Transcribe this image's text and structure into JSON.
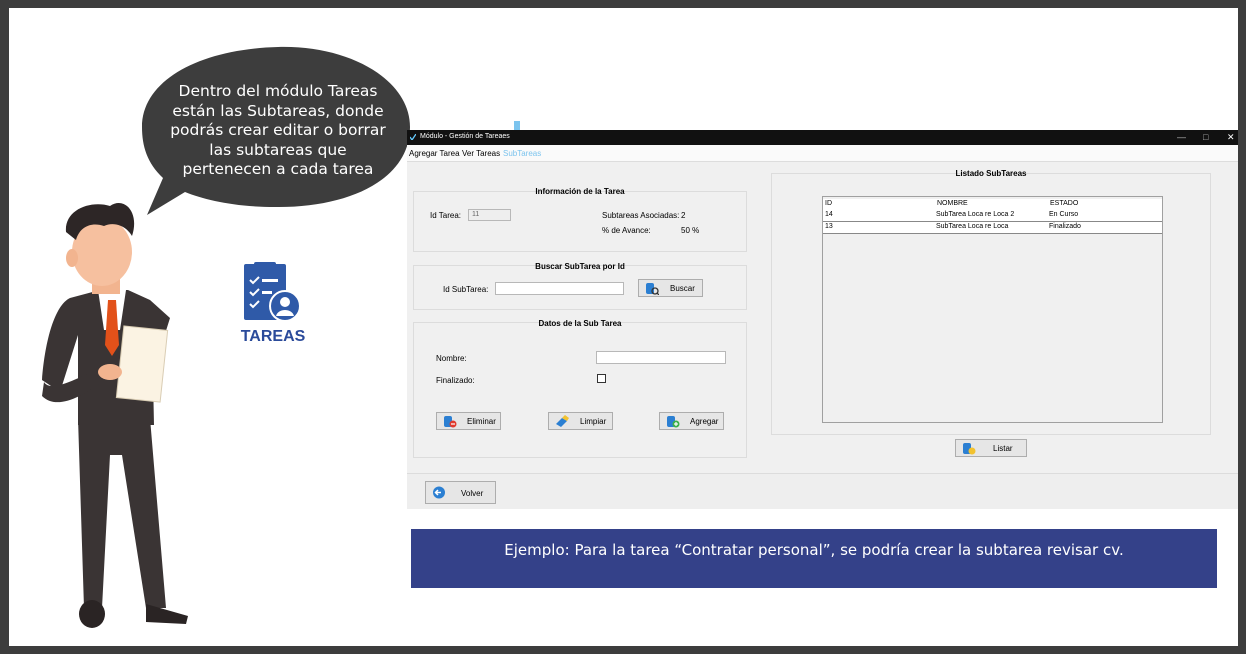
{
  "bubble_text": "Dentro del módulo Tareas están las Subtareas, donde podrás crear editar o borrar las subtareas que pertenecen a cada tarea",
  "app_logo_label": "TAREAS",
  "window": {
    "title": "Módulo - Gestión de Tareaes",
    "controls": {
      "minimize": "—",
      "maximize": "□",
      "close": "✕"
    },
    "tabs": [
      "Agregar Tarea",
      "Ver Tareas",
      "SubTareas"
    ],
    "active_tab": "SubTareas",
    "info_panel": {
      "title": "Información de la Tarea",
      "id_label": "Id Tarea:",
      "id_value": "11",
      "subtasks_label": "Subtareas Asociadas:",
      "subtasks_value": "2",
      "progress_label": "% de Avance:",
      "progress_value": "50 %"
    },
    "search_panel": {
      "title": "Buscar SubTarea por Id",
      "id_label": "Id SubTarea:",
      "id_value": "",
      "search_button": "Buscar"
    },
    "data_panel": {
      "title": "Datos de la Sub Tarea",
      "name_label": "Nombre:",
      "name_value": "",
      "done_label": "Finalizado:",
      "delete_button": "Eliminar",
      "clear_button": "Limpiar",
      "add_button": "Agregar"
    },
    "list_panel": {
      "title": "Listado SubTareas",
      "columns": [
        "ID",
        "NOMBRE",
        "ESTADO"
      ],
      "rows": [
        [
          "14",
          "SubTarea Loca re Loca 2",
          "En Curso"
        ],
        [
          "13",
          "SubTarea Loca re Loca",
          "Finalizado"
        ]
      ],
      "list_button": "Listar"
    },
    "back_button": "Volver"
  },
  "banner_text": "Ejemplo: Para la tarea “Contratar personal”, se podría crear la subtarea revisar cv.",
  "colors": {
    "banner": "#344189",
    "bubble": "#3d3d3d",
    "active_tab": "#7cc4ee",
    "logo": "#2a4a9a"
  }
}
